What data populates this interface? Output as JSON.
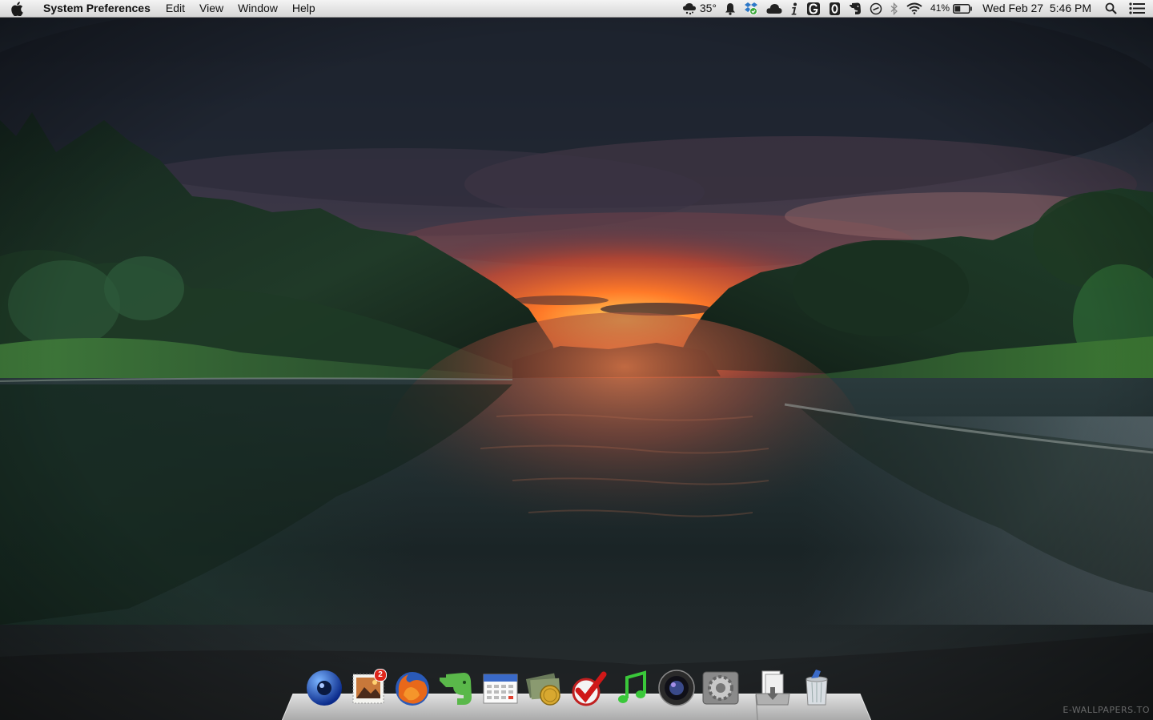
{
  "menubar": {
    "app_name": "System Preferences",
    "menus": [
      "Edit",
      "View",
      "Window",
      "Help"
    ],
    "weather_temp": "35°",
    "battery_percent": "41%",
    "battery_level": 0.41,
    "datetime": "Wed Feb 27  5:46 PM"
  },
  "dock": {
    "items": [
      {
        "icon": "globe-eye-icon"
      },
      {
        "icon": "mail-stamp-icon",
        "badge": "2"
      },
      {
        "icon": "firefox-icon"
      },
      {
        "icon": "evernote-icon"
      },
      {
        "icon": "calendar-icon"
      },
      {
        "icon": "money-icon"
      },
      {
        "icon": "checkmark-icon"
      },
      {
        "icon": "music-note-icon"
      },
      {
        "icon": "camera-lens-icon"
      },
      {
        "icon": "system-preferences-icon"
      },
      {
        "icon": "downloads-stack-icon"
      },
      {
        "icon": "trash-icon"
      }
    ]
  },
  "wallpaper": {
    "watermark": "E-WALLPAPERS.TO"
  },
  "colors": {
    "menubar_top": "#f4f4f4",
    "menubar_bottom": "#d6d6d6",
    "sky_dark": "#1f2731",
    "sunset": "#ff5a1e",
    "foliage": "#2e5a2e",
    "water": "#1c2a2c"
  }
}
